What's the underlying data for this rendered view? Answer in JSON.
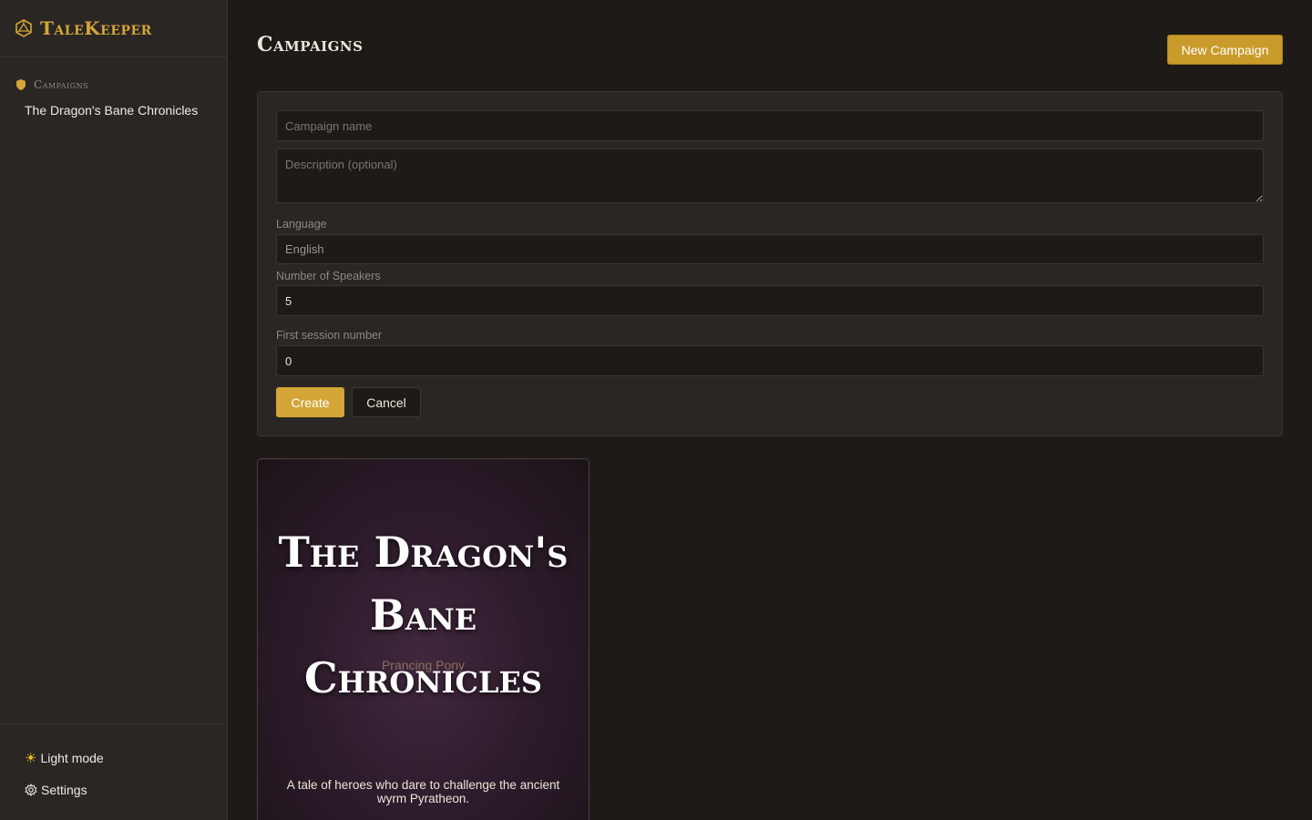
{
  "app": {
    "name": "TaleKeeper",
    "brand_icon": "d20-icon",
    "accent_color": "#d4a537"
  },
  "sidebar": {
    "section_label": "Campaigns",
    "section_icon": "shield-icon",
    "items": [
      {
        "label": "The Dragon's Bane Chronicles"
      }
    ],
    "footer": {
      "light_mode_label": "Light mode",
      "light_mode_icon": "sun-icon",
      "settings_label": "Settings",
      "settings_icon": "gear-icon"
    }
  },
  "main": {
    "title": "Campaigns",
    "new_button_label": "New Campaign",
    "form": {
      "name_placeholder": "Campaign name",
      "name_value": "",
      "description_placeholder": "Description (optional)",
      "description_value": "",
      "language_label": "Language",
      "language_value": "English",
      "speakers_label": "Number of Speakers",
      "speakers_value": "5",
      "session_label": "First session number",
      "session_value": "0",
      "create_label": "Create",
      "cancel_label": "Cancel"
    },
    "campaigns": [
      {
        "title": "The Dragon's Bane Chronicles",
        "subtitle": "Prancing Pony",
        "description": "A tale of heroes who dare to challenge the ancient wyrm Pyratheon."
      }
    ]
  }
}
